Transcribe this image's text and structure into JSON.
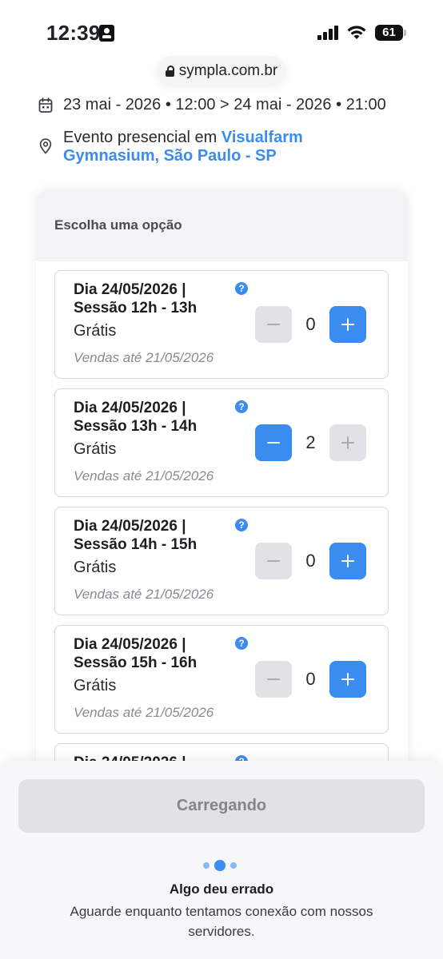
{
  "status_bar": {
    "time": "12:39",
    "battery": "61"
  },
  "browser": {
    "url": "sympla.com.br"
  },
  "event": {
    "date_range": "23 mai - 2026 • 12:00 > 24 mai - 2026 • 21:00",
    "location_prefix": "Evento presencial em",
    "location_link": "Visualfarm Gymnasium, São Paulo - SP"
  },
  "options": {
    "title": "Escolha uma opção",
    "tickets": [
      {
        "name": "Dia 24/05/2026 | Sessão 12h - 13h",
        "price": "Grátis",
        "sales_until": "Vendas até 21/05/2026",
        "quantity": "0",
        "minus_enabled": false,
        "plus_enabled": true
      },
      {
        "name": "Dia 24/05/2026 | Sessão 13h - 14h",
        "price": "Grátis",
        "sales_until": "Vendas até 21/05/2026",
        "quantity": "2",
        "minus_enabled": true,
        "plus_enabled": false
      },
      {
        "name": "Dia 24/05/2026 | Sessão 14h - 15h",
        "price": "Grátis",
        "sales_until": "Vendas até 21/05/2026",
        "quantity": "0",
        "minus_enabled": false,
        "plus_enabled": true
      },
      {
        "name": "Dia 24/05/2026 | Sessão 15h - 16h",
        "price": "Grátis",
        "sales_until": "Vendas até 21/05/2026",
        "quantity": "0",
        "minus_enabled": false,
        "plus_enabled": true
      },
      {
        "name": "Dia 24/05/2026 |",
        "price": "",
        "sales_until": "",
        "quantity": "",
        "minus_enabled": false,
        "plus_enabled": true
      }
    ]
  },
  "bottom_sheet": {
    "button_label": "Carregando",
    "error_title": "Algo deu errado",
    "error_message": "Aguarde enquanto tentamos conexão com nossos servidores."
  },
  "colors": {
    "accent": "#3b8cf0",
    "disabled": "#e1e1e6"
  }
}
